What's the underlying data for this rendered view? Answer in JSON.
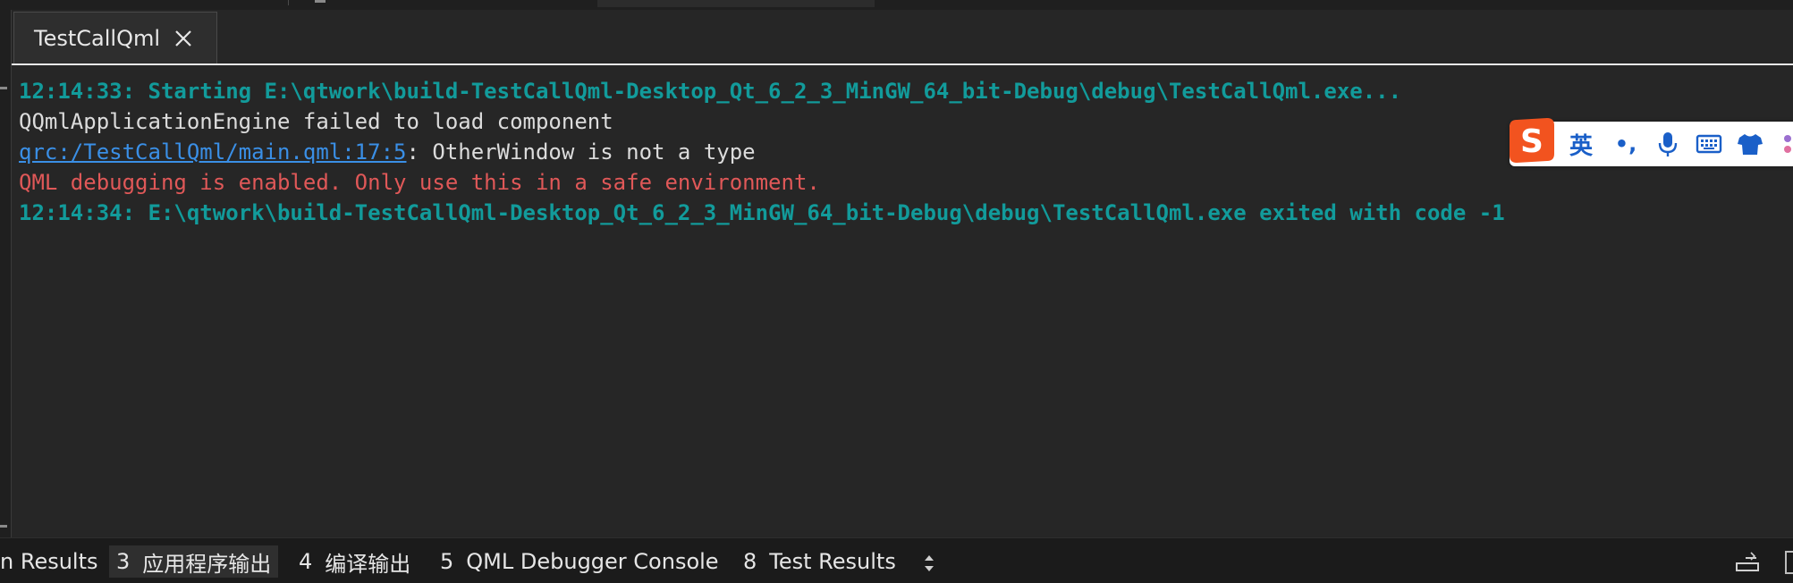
{
  "tab": {
    "title": "TestCallQml",
    "close_icon": "close-icon"
  },
  "output": {
    "lines": [
      {
        "text": "12:14:33: Starting E:\\qtwork\\build-TestCallQml-Desktop_Qt_6_2_3_MinGW_64_bit-Debug\\debug\\TestCallQml.exe...",
        "style": "teal"
      },
      {
        "text": "QQmlApplicationEngine failed to load component",
        "style": "plain"
      },
      {
        "link": "qrc:/TestCallQml/main.qml:17:5",
        "text": ": OtherWindow is not a type",
        "style": "plain"
      },
      {
        "text": "QML debugging is enabled. Only use this in a safe environment.",
        "style": "error"
      },
      {
        "text": "12:14:34: E:\\qtwork\\build-TestCallQml-Desktop_Qt_6_2_3_MinGW_64_bit-Debug\\debug\\TestCallQml.exe exited with code -1",
        "style": "teal"
      }
    ]
  },
  "ime": {
    "logo_icon": "sogou-logo-icon",
    "lang_label": "英",
    "punct_label": "•,",
    "mic_icon": "microphone-icon",
    "keyboard_icon": "keyboard-icon",
    "skin_icon": "shirt-icon"
  },
  "bottom_bar": {
    "panes": [
      {
        "label": "n Results",
        "number": ""
      },
      {
        "label": "应用程序输出",
        "number": "3"
      },
      {
        "label": "编译输出",
        "number": "4"
      },
      {
        "label": "QML Debugger Console",
        "number": "5"
      },
      {
        "label": "Test Results",
        "number": "8"
      }
    ],
    "arrows_icon": "up-down-arrows-icon",
    "right_icon": "minimize-panel-icon"
  },
  "colors": {
    "teal": "#129b9b",
    "error": "#e05858",
    "link": "#3a8fe6",
    "plain": "#dcdcdc",
    "background": "#262626"
  }
}
